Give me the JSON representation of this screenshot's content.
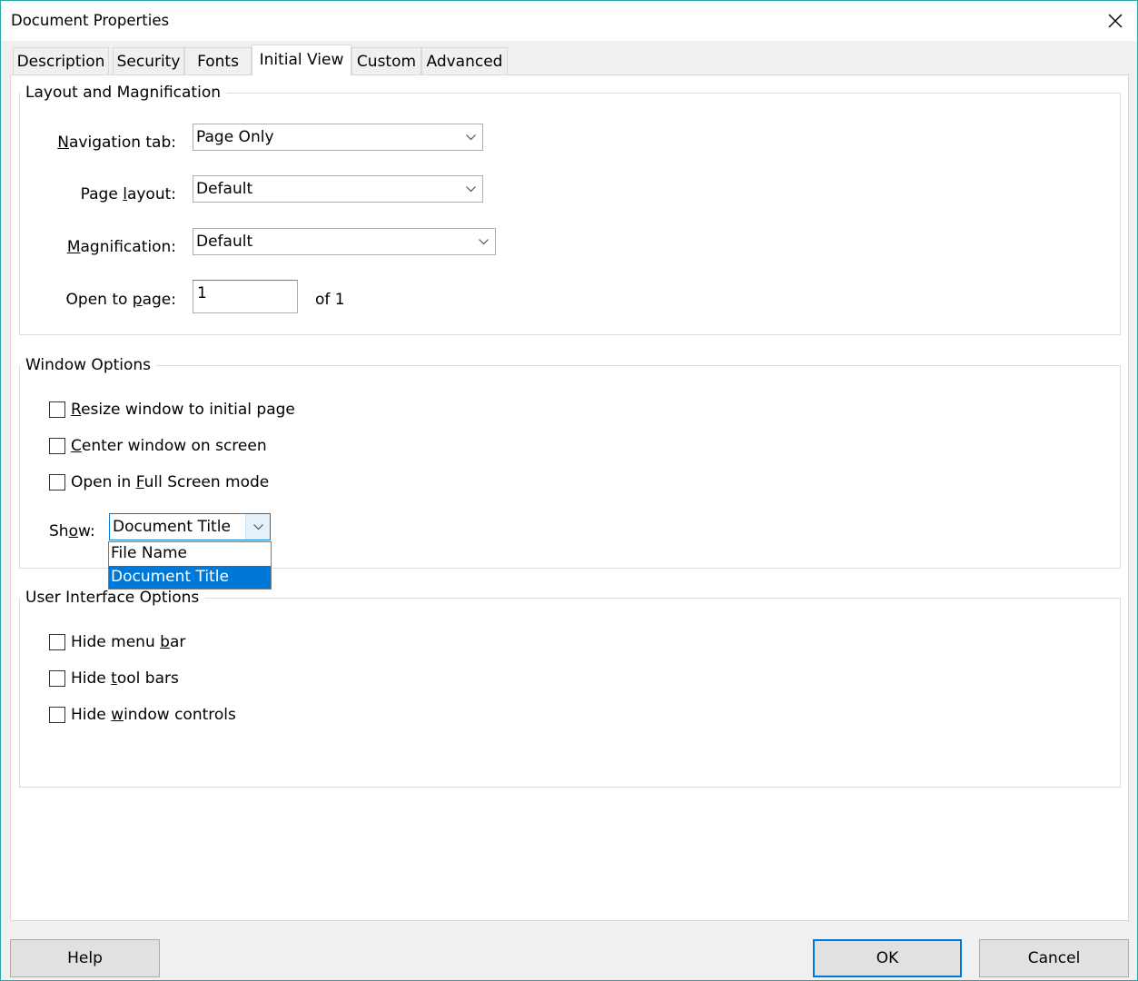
{
  "window": {
    "title": "Document Properties"
  },
  "tabs": [
    {
      "label": "Description"
    },
    {
      "label": "Security"
    },
    {
      "label": "Fonts"
    },
    {
      "label": "Initial View"
    },
    {
      "label": "Custom"
    },
    {
      "label": "Advanced"
    }
  ],
  "layout_group": {
    "title": "Layout and Magnification",
    "navigation_tab": {
      "label": "Navigation tab:",
      "value": "Page Only"
    },
    "page_layout": {
      "label": "Page layout:",
      "value": "Default"
    },
    "magnification": {
      "label": "Magnification:",
      "value": "Default"
    },
    "open_to_page": {
      "label": "Open to page:",
      "value": "1",
      "of_text": "of 1"
    }
  },
  "window_group": {
    "title": "Window Options",
    "resize": {
      "label": "Resize window to initial page",
      "checked": false
    },
    "center": {
      "label": "Center window on screen",
      "checked": false
    },
    "fullscreen": {
      "label": "Open in Full Screen mode",
      "checked": false
    },
    "show": {
      "label": "Show:",
      "value": "Document Title",
      "options": [
        "File Name",
        "Document Title"
      ],
      "highlighted": "Document Title"
    }
  },
  "ui_group": {
    "title": "User Interface Options",
    "hide_menu": {
      "label": "Hide menu bar",
      "checked": false
    },
    "hide_toolbars": {
      "label": "Hide tool bars",
      "checked": false
    },
    "hide_window_controls": {
      "label": "Hide window controls",
      "checked": false
    }
  },
  "buttons": {
    "help": "Help",
    "ok": "OK",
    "cancel": "Cancel"
  },
  "colors": {
    "accent": "#0078d7",
    "window_border": "#2aa6a6",
    "dialog_bg": "#f0f0f0"
  },
  "icons": {
    "close": "close-icon",
    "combo_arrow": "chevron-down-icon"
  }
}
